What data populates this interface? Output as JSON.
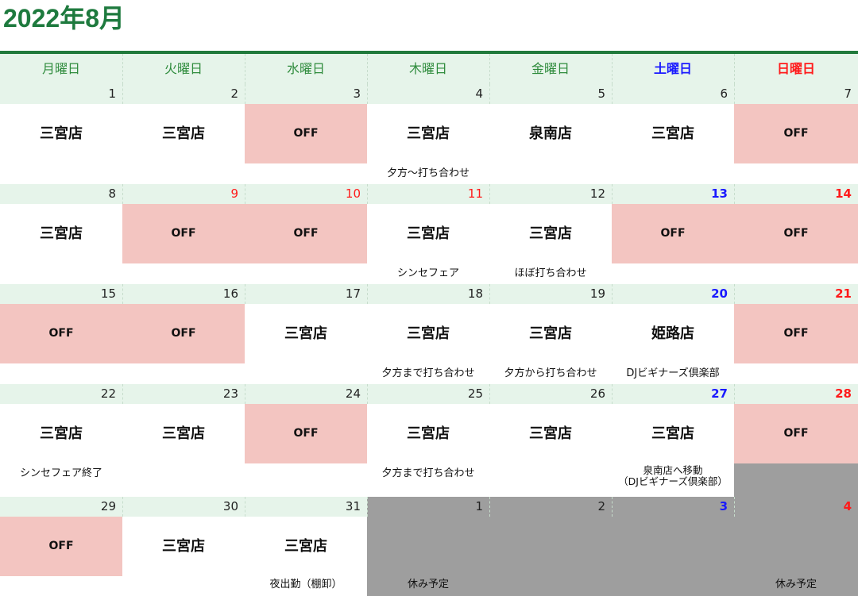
{
  "title": "2022年8月",
  "weekdays": [
    {
      "label": "月曜日",
      "kind": "weekday"
    },
    {
      "label": "火曜日",
      "kind": "weekday"
    },
    {
      "label": "水曜日",
      "kind": "weekday"
    },
    {
      "label": "木曜日",
      "kind": "weekday"
    },
    {
      "label": "金曜日",
      "kind": "weekday"
    },
    {
      "label": "土曜日",
      "kind": "sat"
    },
    {
      "label": "日曜日",
      "kind": "sun"
    }
  ],
  "colors": {
    "title": "#1e7a3e",
    "header_band": "#e6f4ea",
    "off_cell": "#f3c5c1",
    "other_month": "#9e9e9e",
    "saturday": "#1a1aff",
    "sunday_holiday": "#ff1a1a"
  },
  "weeks": [
    [
      {
        "day": "1",
        "loc": "三宮店",
        "note": ""
      },
      {
        "day": "2",
        "loc": "三宮店",
        "note": ""
      },
      {
        "day": "3",
        "loc": "OFF",
        "note": ""
      },
      {
        "day": "4",
        "loc": "三宮店",
        "note": "夕方～打ち合わせ"
      },
      {
        "day": "5",
        "loc": "泉南店",
        "note": ""
      },
      {
        "day": "6",
        "loc": "三宮店",
        "note": ""
      },
      {
        "day": "7",
        "loc": "OFF",
        "note": ""
      }
    ],
    [
      {
        "day": "8",
        "loc": "三宮店",
        "note": ""
      },
      {
        "day": "9",
        "loc": "OFF",
        "note": "",
        "red": true
      },
      {
        "day": "10",
        "loc": "OFF",
        "note": "",
        "red": true
      },
      {
        "day": "11",
        "loc": "三宮店",
        "note": "シンセフェア",
        "red": true
      },
      {
        "day": "12",
        "loc": "三宮店",
        "note": "ほぼ打ち合わせ"
      },
      {
        "day": "13",
        "loc": "OFF",
        "note": "",
        "blue": true
      },
      {
        "day": "14",
        "loc": "OFF",
        "note": "",
        "sunb": true
      }
    ],
    [
      {
        "day": "15",
        "loc": "OFF",
        "note": ""
      },
      {
        "day": "16",
        "loc": "OFF",
        "note": ""
      },
      {
        "day": "17",
        "loc": "三宮店",
        "note": ""
      },
      {
        "day": "18",
        "loc": "三宮店",
        "note": "夕方まで打ち合わせ"
      },
      {
        "day": "19",
        "loc": "三宮店",
        "note": "夕方から打ち合わせ"
      },
      {
        "day": "20",
        "loc": "姫路店",
        "note": "DJビギナーズ倶楽部",
        "blue": true
      },
      {
        "day": "21",
        "loc": "OFF",
        "note": "",
        "sunb": true
      }
    ],
    [
      {
        "day": "22",
        "loc": "三宮店",
        "note": "シンセフェア終了"
      },
      {
        "day": "23",
        "loc": "三宮店",
        "note": ""
      },
      {
        "day": "24",
        "loc": "OFF",
        "note": ""
      },
      {
        "day": "25",
        "loc": "三宮店",
        "note": "夕方まで打ち合わせ"
      },
      {
        "day": "26",
        "loc": "三宮店",
        "note": ""
      },
      {
        "day": "27",
        "loc": "三宮店",
        "note": "泉南店へ移動\n（DJビギナーズ倶楽部）",
        "blue": true
      },
      {
        "day": "28",
        "loc": "OFF",
        "note": "",
        "sunb": true,
        "grey_bottom": true
      }
    ],
    [
      {
        "day": "29",
        "loc": "OFF",
        "note": ""
      },
      {
        "day": "30",
        "loc": "三宮店",
        "note": ""
      },
      {
        "day": "31",
        "loc": "三宮店",
        "note": "夜出勤（棚卸）"
      },
      {
        "day": "1",
        "loc": "",
        "note": "休み予定",
        "other": true
      },
      {
        "day": "2",
        "loc": "",
        "note": "",
        "other": true
      },
      {
        "day": "3",
        "loc": "",
        "note": "",
        "other": true,
        "blue": true
      },
      {
        "day": "4",
        "loc": "",
        "note": "休み予定",
        "other": true,
        "sunb": true
      }
    ]
  ]
}
